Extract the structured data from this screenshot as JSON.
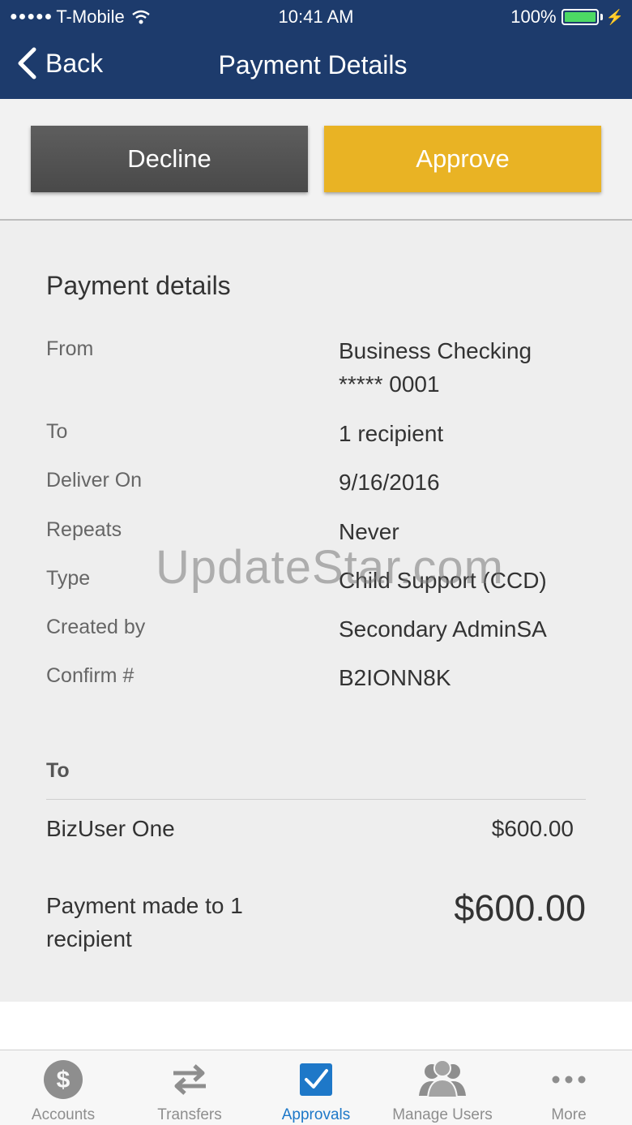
{
  "status_bar": {
    "carrier": "T-Mobile",
    "time": "10:41 AM",
    "battery": "100%"
  },
  "nav": {
    "back_label": "Back",
    "title": "Payment Details"
  },
  "actions": {
    "decline_label": "Decline",
    "approve_label": "Approve",
    "approve_color": "#e9b324",
    "decline_color": "#555555"
  },
  "details": {
    "section_title": "Payment details",
    "rows": [
      {
        "label": "From",
        "value_line1": "Business Checking",
        "value_line2": "***** 0001"
      },
      {
        "label": "To",
        "value": "1 recipient"
      },
      {
        "label": "Deliver On",
        "value": "9/16/2016"
      },
      {
        "label": "Repeats",
        "value": "Never"
      },
      {
        "label": "Type",
        "value": "Child Support (CCD)"
      },
      {
        "label": "Created by",
        "value": "Secondary AdminSA"
      },
      {
        "label": "Confirm #",
        "value": "B2IONN8K"
      }
    ],
    "to_header": "To",
    "recipients": [
      {
        "name": "BizUser One",
        "amount": "$600.00"
      }
    ],
    "total_label": "Payment made to 1 recipient",
    "total_amount": "$600.00"
  },
  "watermark": "UpdateStar.com",
  "tabbar": {
    "tabs": [
      {
        "label": "Accounts",
        "icon": "dollar-icon"
      },
      {
        "label": "Transfers",
        "icon": "transfer-arrows-icon"
      },
      {
        "label": "Approvals",
        "icon": "checkbox-icon",
        "active": true
      },
      {
        "label": "Manage Users",
        "icon": "users-icon"
      },
      {
        "label": "More",
        "icon": "more-dots-icon"
      }
    ],
    "active_color": "#1e78c8",
    "inactive_color": "#8e8e8e"
  },
  "colors": {
    "header_bg": "#1d3b6c",
    "panel_bg": "#eeeeee"
  }
}
